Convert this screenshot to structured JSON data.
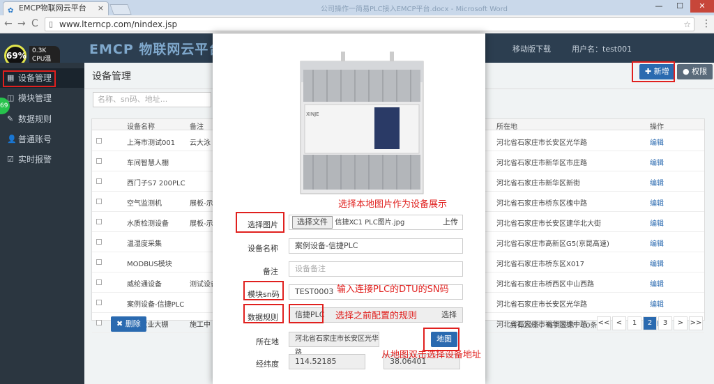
{
  "browser": {
    "tab_title": "EMCP物联网云平台",
    "tab_close": "×",
    "window_title": "公司操作一简易PLC接入EMCP平台.docx - Microsoft Word",
    "url": "www.lterncp.com/nindex.jsp",
    "win_min": "—",
    "win_max": "☐",
    "win_close": "✕",
    "back": "←",
    "forward": "→",
    "reload": "C",
    "star": "☆",
    "menu": "⋮"
  },
  "header": {
    "logo": "EMCP 物联网云平台",
    "links": [
      "移动版下载",
      "用户名：test001"
    ]
  },
  "cpu": {
    "percent": "69%",
    "line1": "0.3K",
    "line2": "CPU温度"
  },
  "sidebar": {
    "items": [
      {
        "label": "设备管理",
        "icon": "▦"
      },
      {
        "label": "模块管理",
        "icon": "◫"
      },
      {
        "label": "数据规则",
        "icon": "✎"
      },
      {
        "label": "普通账号",
        "icon": "👤"
      },
      {
        "label": "实时报警",
        "icon": "☑"
      }
    ],
    "green_badge": "69"
  },
  "main": {
    "title": "设备管理",
    "new_btn": "✚ 新增",
    "perm_btn": "权限",
    "search_placeholder": "名称、sn码、地址...",
    "columns": [
      "设备名称",
      "备注",
      "所在地",
      "操作"
    ],
    "rows": [
      {
        "name": "上海市测试001",
        "note": "云大泳",
        "loc": "河北省石家庄市长安区光华路",
        "op": "编辑"
      },
      {
        "name": "车间智慧人棚",
        "note": "",
        "loc": "河北省石家庄市新华区市庄路",
        "op": "编辑"
      },
      {
        "name": "西门子S7 200PLC",
        "note": "",
        "loc": "河北省石家庄市新华区新街",
        "op": "编辑"
      },
      {
        "name": "空气监测机",
        "note": "展板-示",
        "loc": "河北省石家庄市桥东区槐中路",
        "op": "编辑"
      },
      {
        "name": "水质检测设备",
        "note": "展板-示",
        "loc": "河北省石家庄市长安区建华北大街",
        "op": "编辑"
      },
      {
        "name": "温湿度采集",
        "note": "",
        "loc": "河北省石家庄市高新区G5(京昆高速)",
        "op": "编辑"
      },
      {
        "name": "MODBUS模块",
        "note": "",
        "loc": "河北省石家庄市桥东区X017",
        "op": "编辑"
      },
      {
        "name": "威纶通设备",
        "note": "测试设备",
        "loc": "河北省石家庄市桥西区中山西路",
        "op": "编辑"
      },
      {
        "name": "案例设备-信捷PLC",
        "note": "",
        "loc": "河北省石家庄市长安区光华路",
        "op": "编辑"
      },
      {
        "name": "WII-农业大棚",
        "note": "施工中",
        "loc": "河北省石家庄市裕华区槐中路",
        "op": "编辑"
      }
    ],
    "delete_btn": "✖ 删除",
    "pager_info": "共有22条，每页显示：10条",
    "pages": [
      "<<",
      "<",
      "1",
      "2",
      "3",
      ">",
      ">>"
    ],
    "active_page": "2"
  },
  "modal": {
    "fields": {
      "image_label": "选择图片",
      "choose_file": "选择文件",
      "file_name": "信捷XC1 PLC图片.jpg",
      "upload": "上传",
      "name_label": "设备名称",
      "name_value": "案例设备-信捷PLC",
      "note_label": "备注",
      "note_placeholder": "设备备注",
      "sn_label": "模块sn码",
      "sn_value": "TEST0003",
      "rule_label": "数据规则",
      "rule_value": "信捷PLC",
      "rule_select": "选择",
      "loc_label": "所在地",
      "loc_value": "河北省石家庄市长安区光华路",
      "map_btn": "地图",
      "coord_label": "经纬度",
      "lng": "114.52185",
      "lat": "38.06401"
    },
    "annotations": {
      "pic": "选择本地图片作为设备展示",
      "sn": "输入连接PLC的DTU的SN码",
      "rule": "选择之前配置的规则",
      "map": "从地图双击选择设备地址"
    },
    "plc_brand": "XINJE"
  },
  "colors": {
    "accent": "#2a6ab0",
    "annotation": "#e0201e",
    "sidebar": "#2b3640",
    "header": "#2c3e50"
  }
}
